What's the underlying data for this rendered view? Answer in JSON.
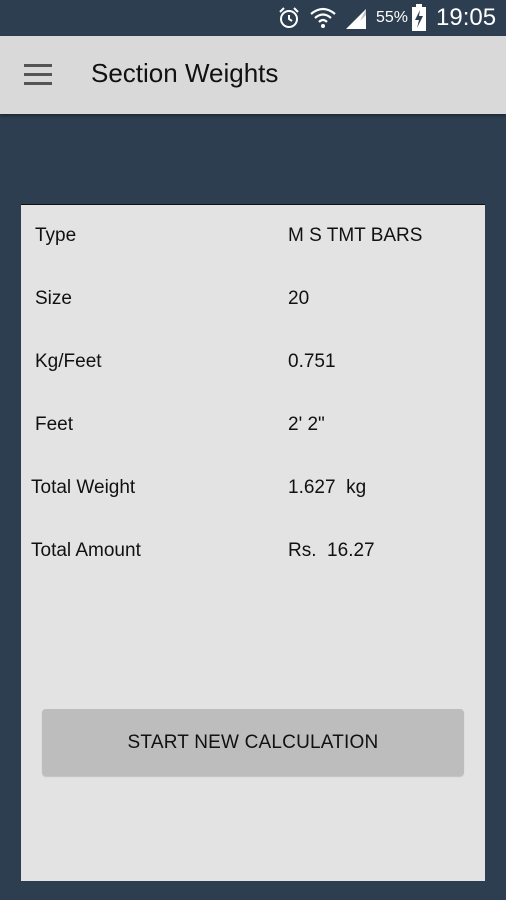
{
  "status_bar": {
    "battery_percent": "55%",
    "time": "19:05",
    "icons": [
      "alarm-icon",
      "wifi-icon",
      "signal-icon",
      "battery-charging-icon"
    ]
  },
  "app_bar": {
    "title": "Section Weights",
    "menu_icon": "hamburger-menu-icon"
  },
  "results": {
    "type_label": "Type",
    "type_value": "M S TMT BARS",
    "size_label": "Size",
    "size_value": "20",
    "kg_per_feet_label": "Kg/Feet",
    "kg_per_feet_value": "0.751",
    "feet_label": "Feet",
    "feet_value": "2' 2\"",
    "total_weight_label": "Total Weight",
    "total_weight_value": "1.627  kg",
    "total_amount_label": "Total Amount",
    "total_amount_value": "Rs.  16.27"
  },
  "actions": {
    "start_new_label": "START NEW CALCULATION"
  },
  "colors": {
    "background": "#2c3e50",
    "app_bar": "#d9d9d9",
    "card": "#e3e3e3",
    "button": "#bdbdbd"
  }
}
